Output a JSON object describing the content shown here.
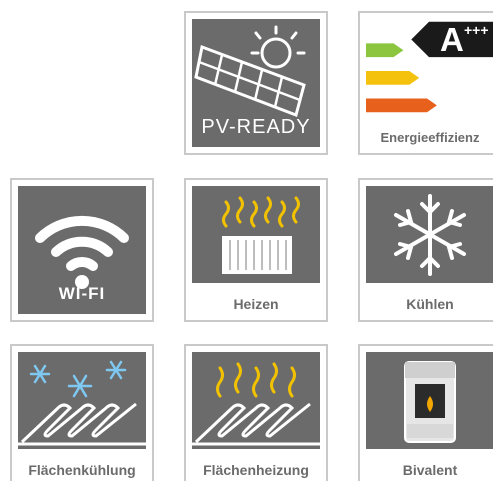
{
  "tiles": {
    "pv_ready": {
      "label": "PV-READY",
      "icon": "solar-panel-sun-icon"
    },
    "energy": {
      "rating_letter": "A",
      "rating_plus": "+++",
      "caption": "Energieeffizienz",
      "icon": "energy-label-icon",
      "colors": {
        "green": "#8cc63f",
        "yellow": "#f4c20d",
        "orange": "#e8611c",
        "black": "#1a1a1a"
      }
    },
    "wifi": {
      "label": "WI-FI",
      "icon": "wifi-icon"
    },
    "heizen": {
      "caption": "Heizen",
      "icon": "radiator-heat-icon"
    },
    "kuehlen": {
      "caption": "Kühlen",
      "icon": "snowflake-icon"
    },
    "flaechenkuehlung": {
      "caption": "Flächenkühlung",
      "icon": "floor-cooling-icon"
    },
    "flaechenheizung": {
      "caption": "Flächenheizung",
      "icon": "floor-heating-icon"
    },
    "bivalent": {
      "caption": "Bivalent",
      "icon": "stove-icon"
    }
  },
  "colors": {
    "panel": "#6b6b6b",
    "accent_yellow": "#f2c200",
    "accent_blue": "#7ec8f2",
    "border": "#c9c9c9"
  }
}
